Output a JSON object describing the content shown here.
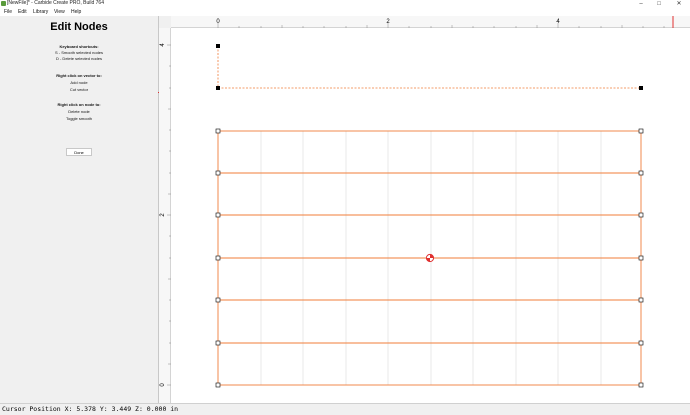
{
  "window": {
    "title": "[NewFile]* - Carbide Create PRO, Build 764",
    "minimize_glyph": "–",
    "maximize_glyph": "□",
    "close_glyph": "✕"
  },
  "menu": {
    "file": "File",
    "edit": "Edit",
    "library": "Library",
    "view": "View",
    "help": "Help"
  },
  "sidebar": {
    "title": "Edit Nodes",
    "shortcuts_header": "Keyboard shortcuts:",
    "shortcut_smooth": "S - Smooth selected nodes",
    "shortcut_delete": "D - Delete selected nodes",
    "vector_header": "Right click on vector to:",
    "add_node": "Add node",
    "cut_vector": "Cut vector",
    "node_header": "Right click on node to:",
    "delete_node": "Delete node",
    "toggle_smooth": "Toggle smooth",
    "done_label": "Done"
  },
  "ruler": {
    "x_labels": [
      "0",
      "2",
      "4"
    ],
    "y_labels": [
      "4",
      "2",
      "0"
    ]
  },
  "status": {
    "text": "Cursor Position X: 5.378 Y: 3.449 Z: 0.000 in"
  },
  "colors": {
    "path": "#f07d3a",
    "node": "#000000",
    "grid": "#dcdcdc",
    "marker": "#e03030",
    "canvas_bg": "#ffffff"
  },
  "icons": {
    "origin": "origin-target-icon",
    "app": "app-icon"
  }
}
